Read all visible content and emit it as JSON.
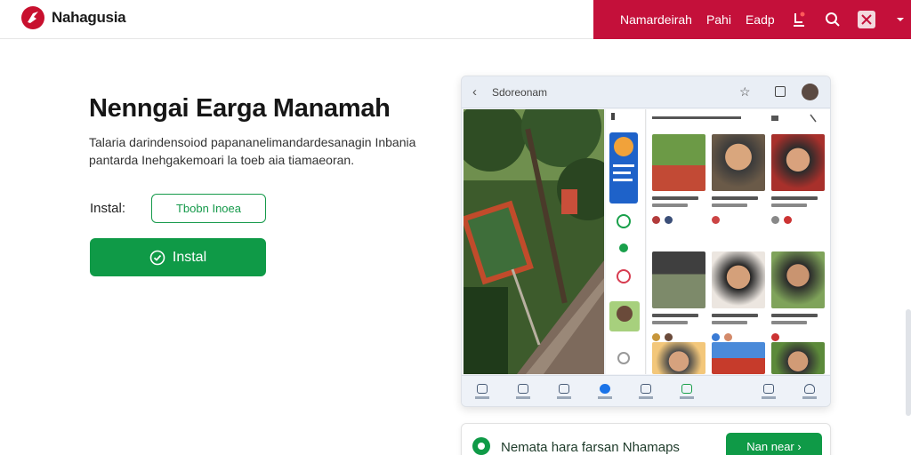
{
  "header": {
    "brand": "Nahagusia",
    "nav": [
      "Namardeirah",
      "Pahi",
      "Eadp"
    ],
    "brand_color": "#c4103a"
  },
  "hero": {
    "title": "Nenngai Earga Manamah",
    "description": "Talaria darindensoiod papananelimandardesanagin Inbania pantarda Inehgakemoari la toeb aia tiamaeoran.",
    "install_label": "Instal:",
    "outline_button": "Tbobn Inoea",
    "install_button": "Instal",
    "accent_color": "#0f9a47"
  },
  "device": {
    "address": "Sdoreonam",
    "icons": [
      "back-icon",
      "star-icon",
      "square-icon",
      "avatar"
    ]
  },
  "banner": {
    "text": "Nemata hara farsan Nhamaps",
    "button": "Nan near"
  }
}
